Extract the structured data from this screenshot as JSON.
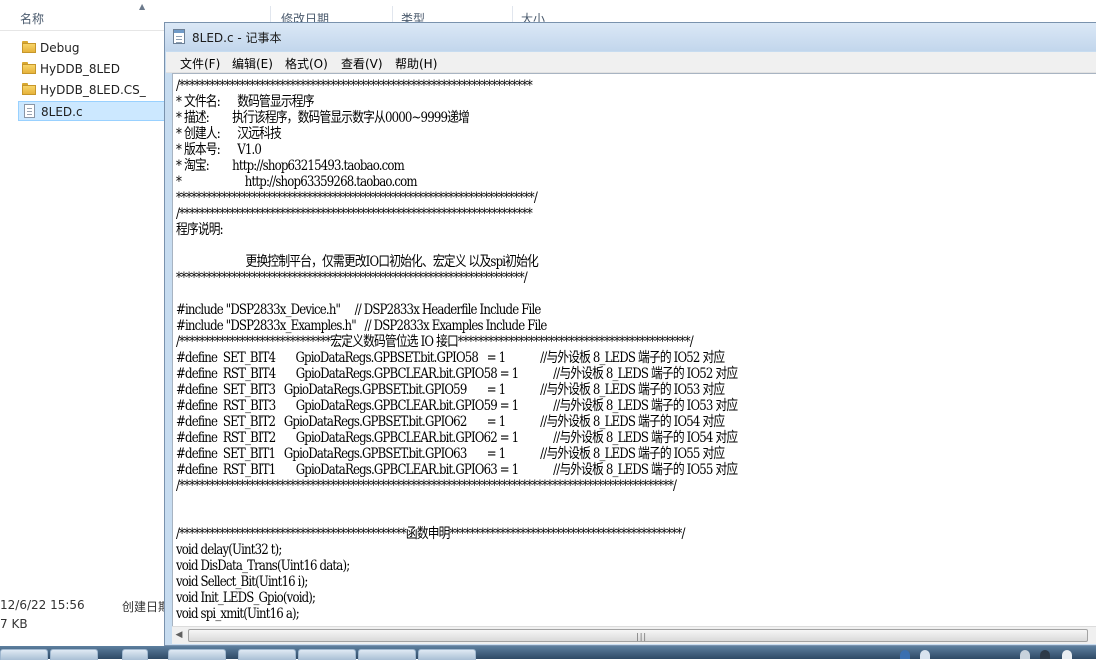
{
  "explorer": {
    "columns": [
      "名称",
      "修改日期",
      "类型",
      "大小"
    ],
    "files": [
      {
        "name": "Debug",
        "kind": "folder"
      },
      {
        "name": "HyDDB_8LED",
        "kind": "folder"
      },
      {
        "name": "HyDDB_8LED.CS_",
        "kind": "folder"
      },
      {
        "name": "8LED.c",
        "kind": "file"
      }
    ],
    "details": {
      "modified": "12/6/22 15:56",
      "created_label": "创建日期",
      "size": "7 KB"
    }
  },
  "notepad": {
    "title": "8LED.c - 记事本",
    "menu": [
      "文件(F)",
      "编辑(E)",
      "格式(O)",
      "查看(V)",
      "帮助(H)"
    ],
    "lines": [
      "/**********************************************************************",
      "* 文件名:      数码管显示程序",
      "* 描述:        执行该程序，数码管显示数字从0000~9999递增",
      "* 创建人:      汉远科技",
      "* 版本号:      V1.0",
      "* 淘宝:        http://shop63215493.taobao.com",
      "*                      http://shop63359268.taobao.com",
      "***********************************************************************/",
      "/**********************************************************************",
      "程序说明:",
      "",
      "                        更换控制平台，仅需更改IO口初始化、宏定义 以及spi初始化",
      "*********************************************************************/",
      "",
      "#include \"DSP2833x_Device.h\"     // DSP2833x Headerfile Include File",
      "#include \"DSP2833x_Examples.h\"   // DSP2833x Examples Include File",
      "/******************************宏定义数码管位选 IO 接口**********************************************/",
      "#define  SET_BIT4       GpioDataRegs.GPBSET.bit.GPIO58   = 1            //与外设板 8_LEDS 端子的 IO52 对应",
      "#define  RST_BIT4       GpioDataRegs.GPBCLEAR.bit.GPIO58 = 1            //与外设板 8_LEDS 端子的 IO52 对应",
      "#define  SET_BIT3   GpioDataRegs.GPBSET.bit.GPIO59       = 1            //与外设板 8_LEDS 端子的 IO53 对应",
      "#define  RST_BIT3       GpioDataRegs.GPBCLEAR.bit.GPIO59 = 1            //与外设板 8_LEDS 端子的 IO53 对应",
      "#define  SET_BIT2   GpioDataRegs.GPBSET.bit.GPIO62       = 1            //与外设板 8_LEDS 端子的 IO54 对应",
      "#define  RST_BIT2       GpioDataRegs.GPBCLEAR.bit.GPIO62 = 1            //与外设板 8_LEDS 端子的 IO54 对应",
      "#define  SET_BIT1   GpioDataRegs.GPBSET.bit.GPIO63       = 1            //与外设板 8_LEDS 端子的 IO55 对应",
      "#define  RST_BIT1       GpioDataRegs.GPBCLEAR.bit.GPIO63 = 1            //与外设板 8_LEDS 端子的 IO55 对应",
      "/**************************************************************************************************/",
      "",
      "",
      "/*********************************************函数申明**********************************************/",
      "void delay(Uint32 t);",
      "void DisData_Trans(Uint16 data);",
      "void Sellect_Bit(Uint16 i);",
      "void Init_LEDS_Gpio(void);",
      "void spi_xmit(Uint16 a);"
    ]
  }
}
